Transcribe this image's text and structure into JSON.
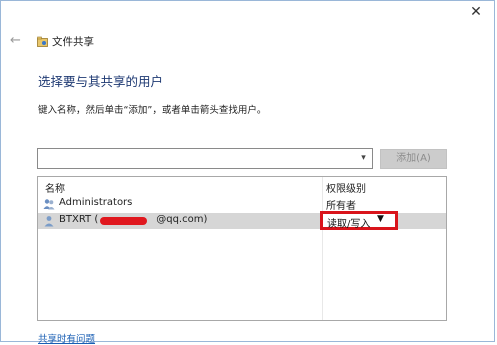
{
  "window": {
    "title": "文件共享",
    "close_glyph": "✕",
    "back_glyph": "←"
  },
  "main": {
    "heading": "选择要与其共享的用户",
    "hint": "键入名称，然后单击“添加”，或者单击箭头查找用户。",
    "input": {
      "value": "",
      "placeholder": ""
    },
    "add_button": "添加(A)"
  },
  "list": {
    "columns": [
      "名称",
      "权限级别"
    ],
    "rows": [
      {
        "name": "Administrators",
        "permission": "所有者",
        "icon": "group-icon"
      },
      {
        "name": "BTXRT (",
        "name_suffix": "@qq.com)",
        "permission": "读取/写入",
        "icon": "user-icon",
        "selected": true
      }
    ]
  },
  "footer": {
    "help_link": "共享时有问题"
  },
  "colors": {
    "accent": "#1a5fb4",
    "highlight_box": "#d9141b",
    "redaction": "#e0181f",
    "selected_row": "#d6d6d6"
  },
  "icons": {
    "dropdown": "▾",
    "perm_dropdown": "▼"
  }
}
